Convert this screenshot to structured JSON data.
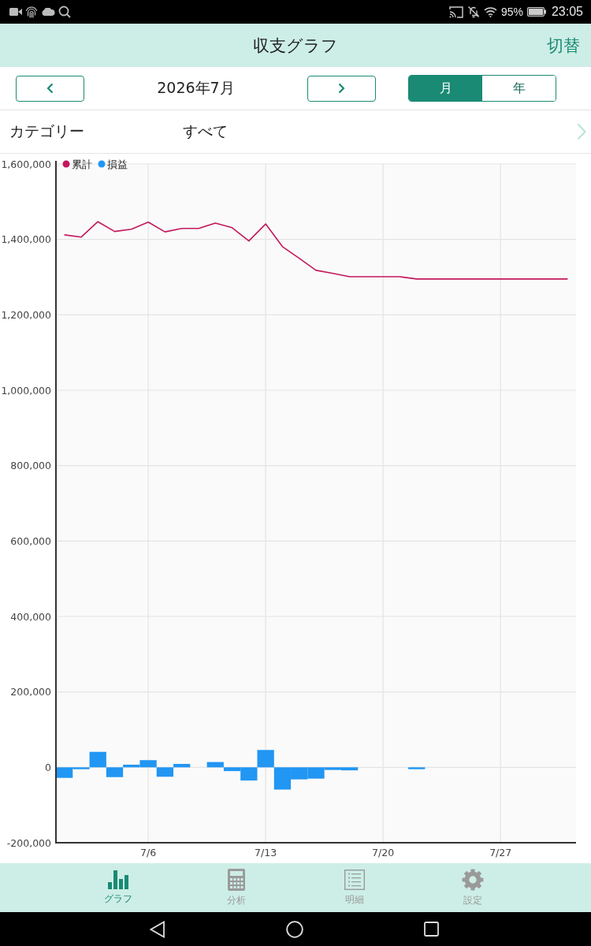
{
  "status_bar": {
    "battery": "95%",
    "time": "23:05"
  },
  "header": {
    "title": "収支グラフ",
    "action": "切替"
  },
  "period": {
    "label": "2026年7月",
    "segments": [
      {
        "label": "月",
        "selected": true
      },
      {
        "label": "年",
        "selected": false
      }
    ]
  },
  "category": {
    "label": "カテゴリー",
    "value": "すべて"
  },
  "chart": {
    "chart_data": {
      "type": "bar",
      "grid": true,
      "legend": "top-left",
      "categories": [
        null,
        null,
        null,
        null,
        null,
        "7/6",
        null,
        null,
        null,
        null,
        null,
        null,
        "7/13",
        null,
        null,
        null,
        null,
        null,
        null,
        "7/20",
        null,
        null,
        null,
        null,
        null,
        null,
        "7/27",
        null,
        null,
        null,
        null
      ],
      "series": [
        {
          "name": "累計",
          "type": "line",
          "color": "#c2185b",
          "values": [
            1412000,
            1406000,
            1447000,
            1421000,
            1427000,
            1446000,
            1420000,
            1429000,
            1429000,
            1443000,
            1431000,
            1396000,
            1441000,
            1381000,
            1350000,
            1318000,
            1310000,
            1301000,
            1301000,
            1301000,
            1301000,
            1295000,
            1295000,
            1295000,
            1295000,
            1295000,
            1295000,
            1295000,
            1295000,
            1295000,
            1295000
          ]
        },
        {
          "name": "損益",
          "color": "#2196f3",
          "values": [
            -28000,
            -5000,
            41000,
            -26000,
            7000,
            19000,
            -25000,
            9000,
            0,
            14000,
            -10000,
            -35000,
            46000,
            -59000,
            -32000,
            -30000,
            -7000,
            -8000,
            0,
            0,
            0,
            -5000,
            0,
            0,
            0,
            0,
            0,
            0,
            0,
            0,
            0
          ]
        }
      ],
      "ylim": [
        -200000,
        1600000
      ],
      "yticks": [
        {
          "value": -200000,
          "label": "-200,000"
        },
        {
          "value": 0,
          "label": "0"
        },
        {
          "value": 200000,
          "label": "200,000"
        },
        {
          "value": 400000,
          "label": "400,000"
        },
        {
          "value": 600000,
          "label": "600,000"
        },
        {
          "value": 800000,
          "label": "800,000"
        },
        {
          "value": 1000000,
          "label": "1,000,000"
        },
        {
          "value": 1200000,
          "label": "1,200,000"
        },
        {
          "value": 1400000,
          "label": "1,400,000"
        },
        {
          "value": 1600000,
          "label": "1,600,000"
        }
      ]
    }
  },
  "bottom_nav": [
    {
      "label": "グラフ",
      "selected": true
    },
    {
      "label": "分析",
      "selected": false
    },
    {
      "label": "明細",
      "selected": false
    },
    {
      "label": "設定",
      "selected": false
    }
  ]
}
